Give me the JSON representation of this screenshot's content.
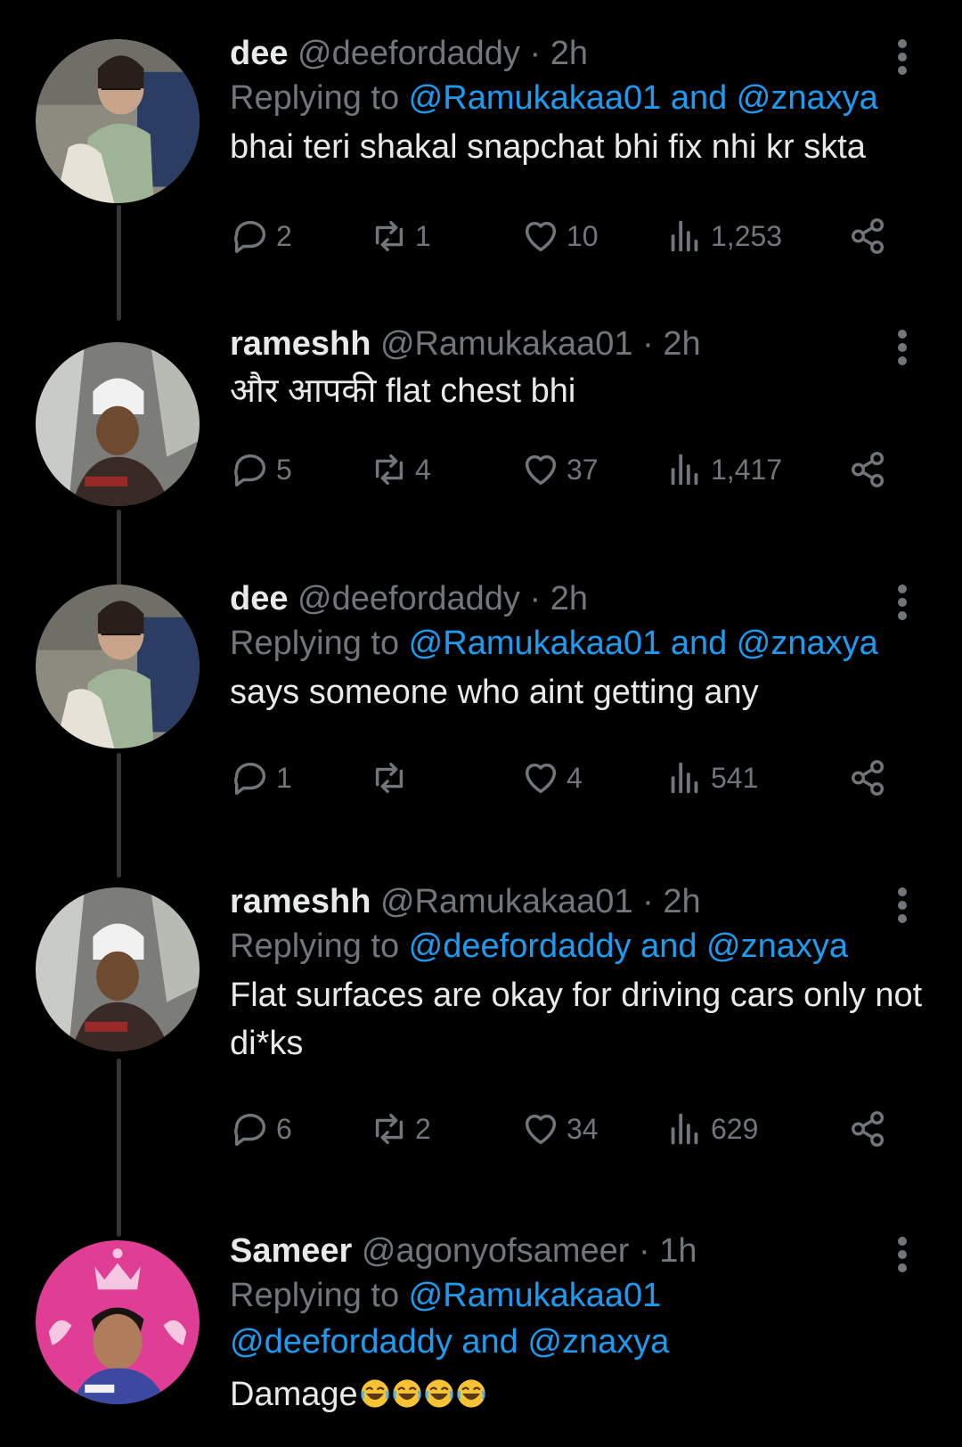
{
  "tweets": [
    {
      "name": "dee",
      "handle": "@deefordaddy",
      "dot": "·",
      "time": "2h",
      "replying": {
        "prefix": "Replying to ",
        "line1": "@Ramukakaa01 and @znaxya",
        "line2": ""
      },
      "text": "bhai teri shakal snapchat bhi fix nhi kr skta",
      "replies": "2",
      "reposts": "1",
      "likes": "10",
      "views": "1,253"
    },
    {
      "name": "rameshh",
      "handle": "@Ramukakaa01",
      "dot": "·",
      "time": "2h",
      "replying": null,
      "text": "और आपकी flat chest bhi",
      "replies": "5",
      "reposts": "4",
      "likes": "37",
      "views": "1,417"
    },
    {
      "name": "dee",
      "handle": "@deefordaddy",
      "dot": "·",
      "time": "2h",
      "replying": {
        "prefix": "Replying to ",
        "line1": "@Ramukakaa01 and @znaxya",
        "line2": ""
      },
      "text": "says someone who aint getting any",
      "replies": "1",
      "reposts": "",
      "likes": "4",
      "views": "541"
    },
    {
      "name": "rameshh",
      "handle": "@Ramukakaa01",
      "dot": "·",
      "time": "2h",
      "replying": {
        "prefix": "Replying to ",
        "line1": "@deefordaddy and @znaxya",
        "line2": ""
      },
      "text": "Flat surfaces are okay for driving cars only not di*ks",
      "replies": "6",
      "reposts": "2",
      "likes": "34",
      "views": "629"
    },
    {
      "name": "Sameer",
      "handle": "@agonyofsameer",
      "dot": "·",
      "time": "1h",
      "replying": {
        "prefix": "Replying to ",
        "line1": "@Ramukakaa01",
        "line2": "@deefordaddy and @znaxya"
      },
      "text": "Damage",
      "emoji_count": 4
    }
  ],
  "colors": {
    "background": "#000000",
    "text": "#e7e9ea",
    "muted": "#71767b",
    "link": "#1d9bf0"
  },
  "icons": [
    "reply-icon",
    "repost-icon",
    "like-icon",
    "views-icon",
    "share-icon",
    "more-icon",
    "laughing-emoji"
  ]
}
